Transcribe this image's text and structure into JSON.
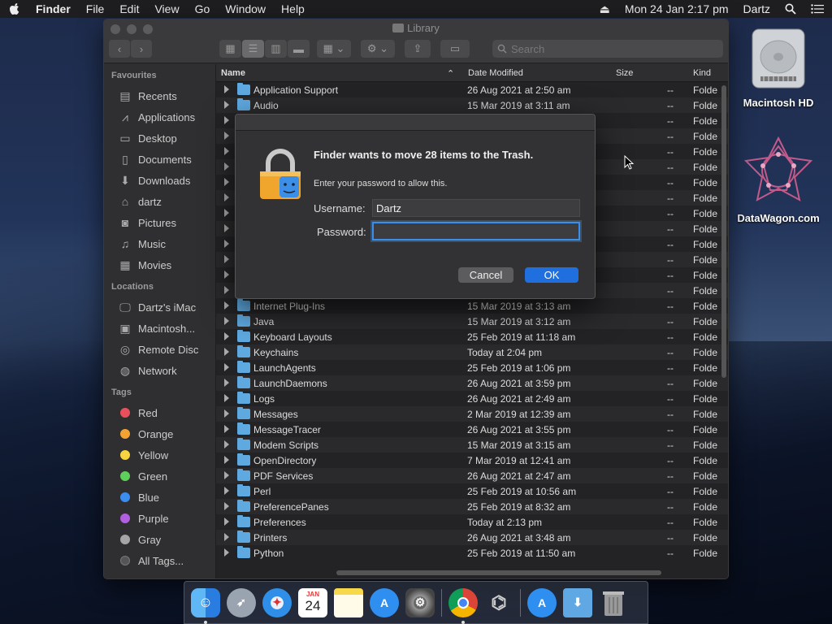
{
  "menubar": {
    "app": "Finder",
    "items": [
      "File",
      "Edit",
      "View",
      "Go",
      "Window",
      "Help"
    ],
    "clock": "Mon 24 Jan  2:17 pm",
    "user": "Dartz"
  },
  "desktop": {
    "icons": [
      {
        "label": "Macintosh HD",
        "icon": "hard-drive-icon"
      },
      {
        "label": "DataWagon.com",
        "icon": "geometric-star-icon"
      }
    ]
  },
  "window": {
    "title": "Library",
    "search_placeholder": "Search",
    "sidebar": {
      "favourites_header": "Favourites",
      "favourites": [
        {
          "label": "Recents",
          "icon": "clock-icon"
        },
        {
          "label": "Applications",
          "icon": "applications-icon"
        },
        {
          "label": "Desktop",
          "icon": "desktop-icon"
        },
        {
          "label": "Documents",
          "icon": "documents-icon"
        },
        {
          "label": "Downloads",
          "icon": "downloads-icon"
        },
        {
          "label": "dartz",
          "icon": "home-icon"
        },
        {
          "label": "Pictures",
          "icon": "camera-icon"
        },
        {
          "label": "Music",
          "icon": "music-icon"
        },
        {
          "label": "Movies",
          "icon": "film-icon"
        }
      ],
      "locations_header": "Locations",
      "locations": [
        {
          "label": "Dartz's iMac",
          "icon": "imac-icon"
        },
        {
          "label": "Macintosh...",
          "icon": "disk-icon"
        },
        {
          "label": "Remote Disc",
          "icon": "disc-icon"
        },
        {
          "label": "Network",
          "icon": "globe-icon"
        }
      ],
      "tags_header": "Tags",
      "tags": [
        {
          "label": "Red",
          "color": "#e8505b"
        },
        {
          "label": "Orange",
          "color": "#f4a233"
        },
        {
          "label": "Yellow",
          "color": "#f6d33f"
        },
        {
          "label": "Green",
          "color": "#5fcf5c"
        },
        {
          "label": "Blue",
          "color": "#3b8df0"
        },
        {
          "label": "Purple",
          "color": "#b15ee0"
        },
        {
          "label": "Gray",
          "color": "#a5a5a8"
        },
        {
          "label": "All Tags...",
          "color": "#555558"
        }
      ]
    },
    "columns": {
      "name": "Name",
      "date": "Date Modified",
      "size": "Size",
      "kind": "Kind"
    },
    "rows": [
      {
        "name": "Application Support",
        "date": "26 Aug 2021 at 2:50 am",
        "size": "--",
        "kind": "Folde"
      },
      {
        "name": "Audio",
        "date": "15 Mar 2019 at 3:11 am",
        "size": "--",
        "kind": "Folde"
      },
      {
        "name": "",
        "date": "",
        "size": "--",
        "kind": "Folde"
      },
      {
        "name": "",
        "date": "",
        "size": "--",
        "kind": "Folde"
      },
      {
        "name": "",
        "date": "",
        "size": "--",
        "kind": "Folde"
      },
      {
        "name": "",
        "date": "",
        "size": "--",
        "kind": "Folde"
      },
      {
        "name": "",
        "date": "",
        "size": "--",
        "kind": "Folde"
      },
      {
        "name": "",
        "date": "",
        "size": "--",
        "kind": "Folde"
      },
      {
        "name": "",
        "date": "",
        "size": "--",
        "kind": "Folde"
      },
      {
        "name": "",
        "date": "",
        "size": "--",
        "kind": "Folde"
      },
      {
        "name": "",
        "date": "",
        "size": "--",
        "kind": "Folde"
      },
      {
        "name": "",
        "date": "",
        "size": "--",
        "kind": "Folde"
      },
      {
        "name": "",
        "date": "",
        "size": "--",
        "kind": "Folde"
      },
      {
        "name": "",
        "date": "",
        "size": "--",
        "kind": "Folde"
      },
      {
        "name": "Internet Plug-Ins",
        "date": "15 Mar 2019 at 3:13 am",
        "size": "--",
        "kind": "Folde"
      },
      {
        "name": "Java",
        "date": "15 Mar 2019 at 3:12 am",
        "size": "--",
        "kind": "Folde"
      },
      {
        "name": "Keyboard Layouts",
        "date": "25 Feb 2019 at 11:18 am",
        "size": "--",
        "kind": "Folde"
      },
      {
        "name": "Keychains",
        "date": "Today at 2:04 pm",
        "size": "--",
        "kind": "Folde"
      },
      {
        "name": "LaunchAgents",
        "date": "25 Feb 2019 at 1:06 pm",
        "size": "--",
        "kind": "Folde"
      },
      {
        "name": "LaunchDaemons",
        "date": "26 Aug 2021 at 3:59 pm",
        "size": "--",
        "kind": "Folde"
      },
      {
        "name": "Logs",
        "date": "26 Aug 2021 at 2:49 am",
        "size": "--",
        "kind": "Folde"
      },
      {
        "name": "Messages",
        "date": "2 Mar 2019 at 12:39 am",
        "size": "--",
        "kind": "Folde"
      },
      {
        "name": "MessageTracer",
        "date": "26 Aug 2021 at 3:55 pm",
        "size": "--",
        "kind": "Folde"
      },
      {
        "name": "Modem Scripts",
        "date": "15 Mar 2019 at 3:15 am",
        "size": "--",
        "kind": "Folde"
      },
      {
        "name": "OpenDirectory",
        "date": "7 Mar 2019 at 12:41 am",
        "size": "--",
        "kind": "Folde"
      },
      {
        "name": "PDF Services",
        "date": "26 Aug 2021 at 2:47 am",
        "size": "--",
        "kind": "Folde"
      },
      {
        "name": "Perl",
        "date": "25 Feb 2019 at 10:56 am",
        "size": "--",
        "kind": "Folde"
      },
      {
        "name": "PreferencePanes",
        "date": "25 Feb 2019 at 8:32 am",
        "size": "--",
        "kind": "Folde"
      },
      {
        "name": "Preferences",
        "date": "Today at 2:13 pm",
        "size": "--",
        "kind": "Folde"
      },
      {
        "name": "Printers",
        "date": "26 Aug 2021 at 3:48 am",
        "size": "--",
        "kind": "Folde"
      },
      {
        "name": "Python",
        "date": "25 Feb 2019 at 11:50 am",
        "size": "--",
        "kind": "Folde"
      }
    ]
  },
  "dialog": {
    "title": "Finder wants to move 28 items to the Trash.",
    "subtitle": "Enter your password to allow this.",
    "username_label": "Username:",
    "username_value": "Dartz",
    "password_label": "Password:",
    "password_value": "",
    "cancel_label": "Cancel",
    "ok_label": "OK"
  },
  "dock": {
    "calendar_month": "JAN",
    "calendar_day": "24",
    "apps": [
      "finder-icon",
      "launchpad-icon",
      "safari-icon",
      "calendar-icon",
      "notes-icon",
      "app-store-icon",
      "system-preferences-icon",
      "chrome-icon",
      "utility-icon",
      "app-store-folder-icon",
      "downloads-folder-icon",
      "trash-icon"
    ]
  }
}
